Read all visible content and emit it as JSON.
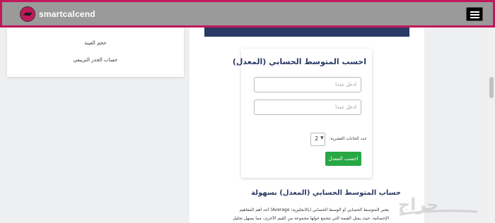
{
  "header": {
    "logo_text": "smartcalcend",
    "brand_color": "#c2185b",
    "bar_color": "#9a9a9a",
    "menu_icon": "hamburger-icon"
  },
  "sidebar": {
    "items": [
      {
        "label": "حجم العينة"
      },
      {
        "label": "حساب الجذر التربيعي"
      }
    ]
  },
  "calculator": {
    "title": "احسب المتوسط الحسابي (المعدل)",
    "input1_placeholder": "أدخل عدداً",
    "input2_placeholder": "أدخل عدداً",
    "decimals_label": "عدد الخانات العشرية:",
    "decimals_value": "2",
    "button_label": "احسب المعدل",
    "button_color": "#28a745"
  },
  "article": {
    "heading": "حساب المتوسط الحسابي (المعدل) بسهولة",
    "line1": "يعتبر المتوسط الحسابي أو الوسط الحسابي (بالانجليزية: Average) أحد أهم المفاهيم",
    "line2": "الإحصائية، حيث يمثل القيمة التي تتجمع حولها مجموعة من القيم الأخرى، مما يسهل تحليل"
  },
  "watermark": {
    "text": "حراج"
  }
}
